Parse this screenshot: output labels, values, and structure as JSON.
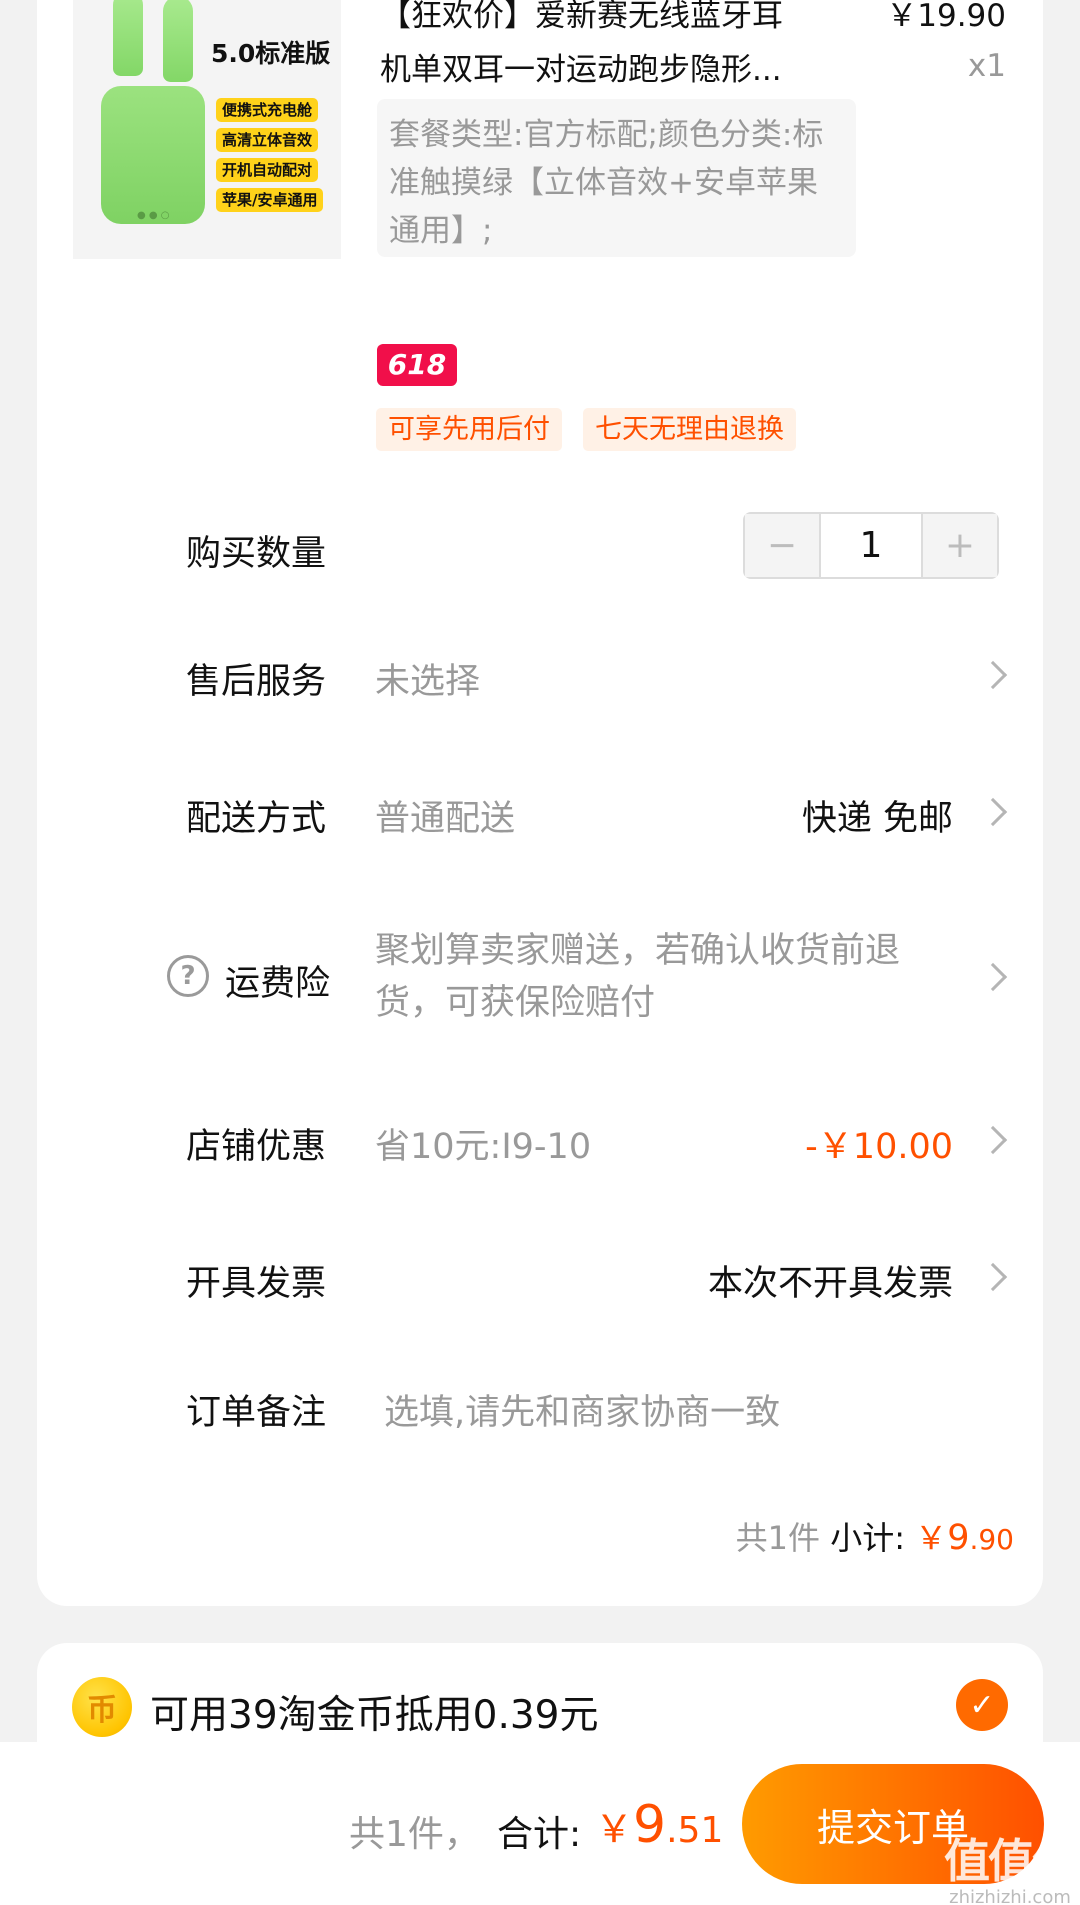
{
  "product": {
    "image": {
      "title": "5.0标准版",
      "features": [
        "便携式充电舱",
        "高清立体音效",
        "开机自动配对",
        "苹果/安卓通用"
      ]
    },
    "title_line1": "【狂欢价】爱新赛无线蓝牙耳",
    "title_line2": "机单双耳一对运动跑步隐形...",
    "price": "￥19.90",
    "quantity_label": "x1",
    "sku": "套餐类型:官方标配;颜色分类:标准触摸绿【立体音效+安卓苹果通用】;",
    "badge": "618",
    "tags": [
      "可享先用后付",
      "七天无理由退换"
    ]
  },
  "rows": {
    "quantity": {
      "label": "购买数量",
      "value": "1",
      "minus": "−",
      "plus": "+"
    },
    "after_sale": {
      "label": "售后服务",
      "value": "未选择"
    },
    "delivery": {
      "label": "配送方式",
      "value": "普通配送",
      "right": "快递 免邮"
    },
    "insurance": {
      "label": "运费险",
      "icon": "?",
      "value": "聚划算卖家赠送，若确认收货前退货，可获保险赔付"
    },
    "shop_discount": {
      "label": "店铺优惠",
      "value": "省10元:I9-10",
      "right": "-￥10.00"
    },
    "invoice": {
      "label": "开具发票",
      "right": "本次不开具发票"
    },
    "remark": {
      "label": "订单备注",
      "placeholder": "选填,请先和商家协商一致"
    }
  },
  "subtotal": {
    "count": "共1件",
    "label": "小计:",
    "currency": "￥",
    "integer": "9",
    "decimal": ".90"
  },
  "coins": {
    "icon": "币",
    "text": "可用39淘金币抵用0.39元",
    "checked": "✓"
  },
  "bottom": {
    "count": "共1件，",
    "label": "合计:",
    "currency": "￥",
    "integer": "9",
    "decimal": ".51",
    "submit": "提交订单"
  },
  "watermark": {
    "logo": "值值值",
    "url": "zhizhizhi.com"
  },
  "colors": {
    "accent": "#ff5000",
    "badge_618": "#f10f4a",
    "submit_start": "#ff9b00",
    "submit_end": "#ff5000"
  }
}
